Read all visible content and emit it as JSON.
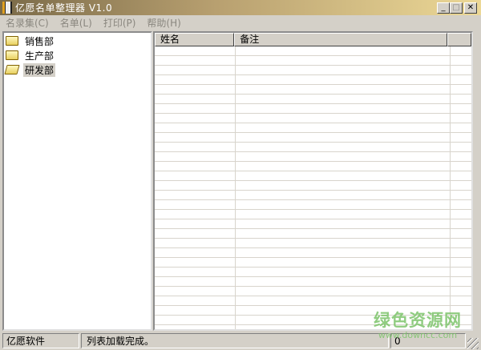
{
  "window": {
    "title": "亿愿名单整理器 V1.0",
    "minimize": "_",
    "maximize": "□",
    "close": "✕"
  },
  "menu": [
    "名录集(C)",
    "名单(L)",
    "打印(P)",
    "帮助(H)"
  ],
  "tree": [
    {
      "label": "销售部",
      "state": "closed"
    },
    {
      "label": "生产部",
      "state": "closed"
    },
    {
      "label": "研发部",
      "state": "open",
      "selected": true
    }
  ],
  "list": {
    "columns": [
      "姓名",
      "备注",
      ""
    ]
  },
  "status": {
    "company": "亿愿软件",
    "message": "列表加载完成。",
    "count": "0"
  },
  "watermark": {
    "name": "绿色资源网",
    "url": "www.downcc.com"
  }
}
